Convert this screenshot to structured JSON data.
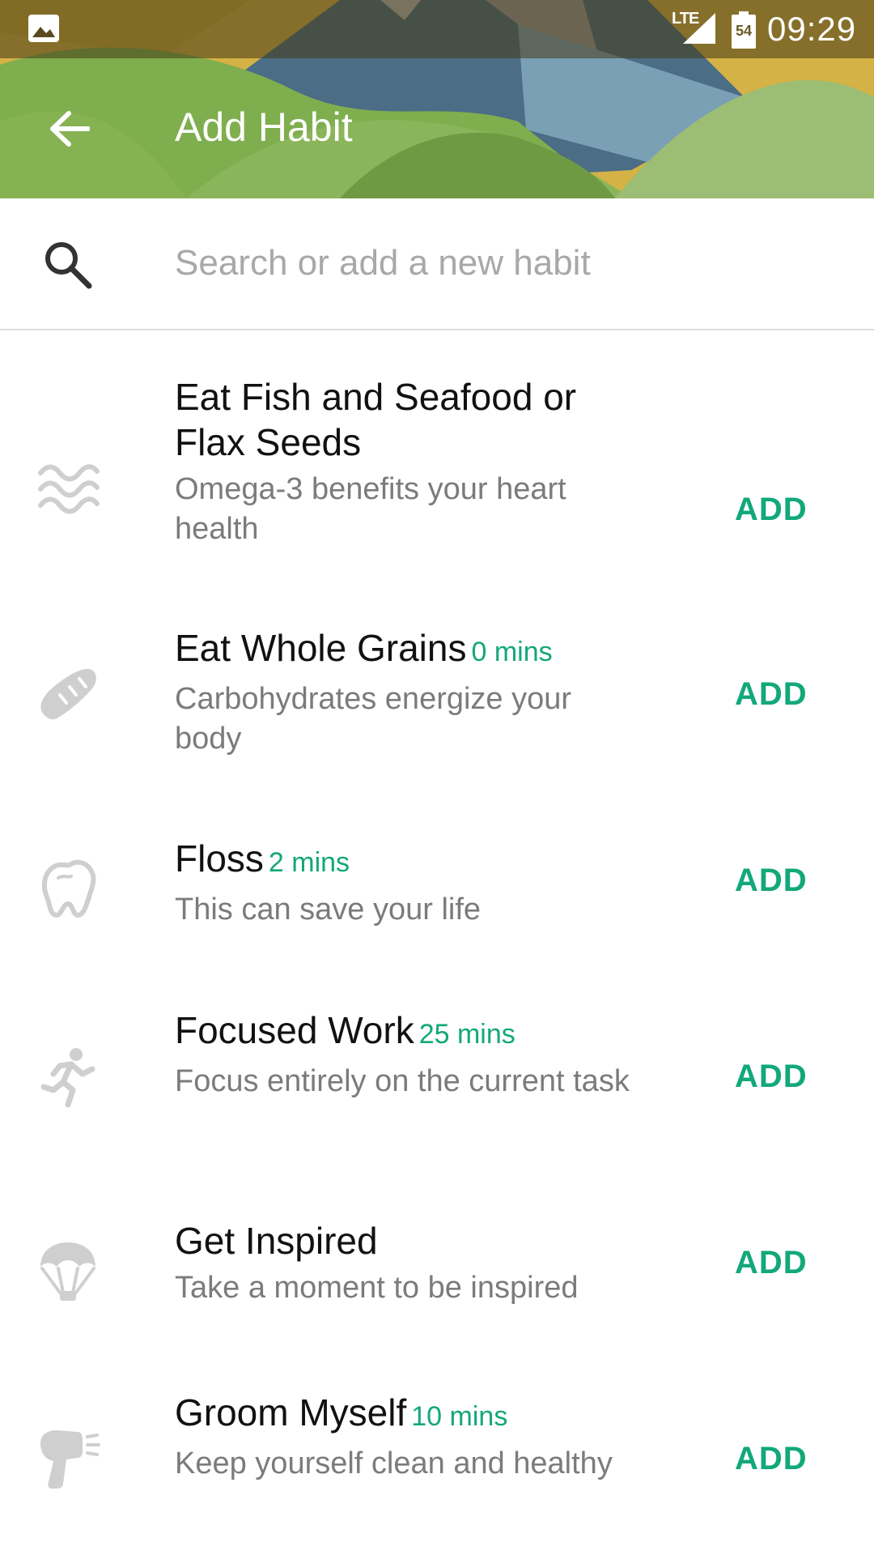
{
  "status_bar": {
    "network": "LTE",
    "battery_level": "54",
    "time": "09:29",
    "icons": [
      "image-notification-icon",
      "signal-icon",
      "battery-icon"
    ]
  },
  "app_bar": {
    "title": "Add Habit",
    "back_icon": "arrow-back-icon"
  },
  "search": {
    "placeholder": "Search or add a new habit",
    "value": "",
    "icon": "search-icon"
  },
  "habits": [
    {
      "icon": "waves-icon",
      "title": "Eat Fish and Seafood or Flax Seeds",
      "duration": "",
      "subtitle": "Omega-3 benefits your heart health",
      "action": "ADD"
    },
    {
      "icon": "bread-icon",
      "title": "Eat Whole Grains",
      "duration": "0 mins",
      "subtitle": "Carbohydrates energize your body",
      "action": "ADD"
    },
    {
      "icon": "tooth-icon",
      "title": "Floss",
      "duration": "2 mins",
      "subtitle": "This can save your life",
      "action": "ADD"
    },
    {
      "icon": "running-person-icon",
      "title": "Focused Work",
      "duration": "25 mins",
      "subtitle": "Focus entirely on the current task",
      "action": "ADD"
    },
    {
      "icon": "parachute-icon",
      "title": "Get Inspired",
      "duration": "",
      "subtitle": "Take a moment to be inspired",
      "action": "ADD"
    },
    {
      "icon": "hair-dryer-icon",
      "title": "Groom Myself",
      "duration": "10 mins",
      "subtitle": "Keep yourself clean and healthy",
      "action": "ADD"
    }
  ],
  "colors": {
    "accent": "#12a87a",
    "header_green": "#7aa64a",
    "icon_gray": "#cfcfcf"
  }
}
